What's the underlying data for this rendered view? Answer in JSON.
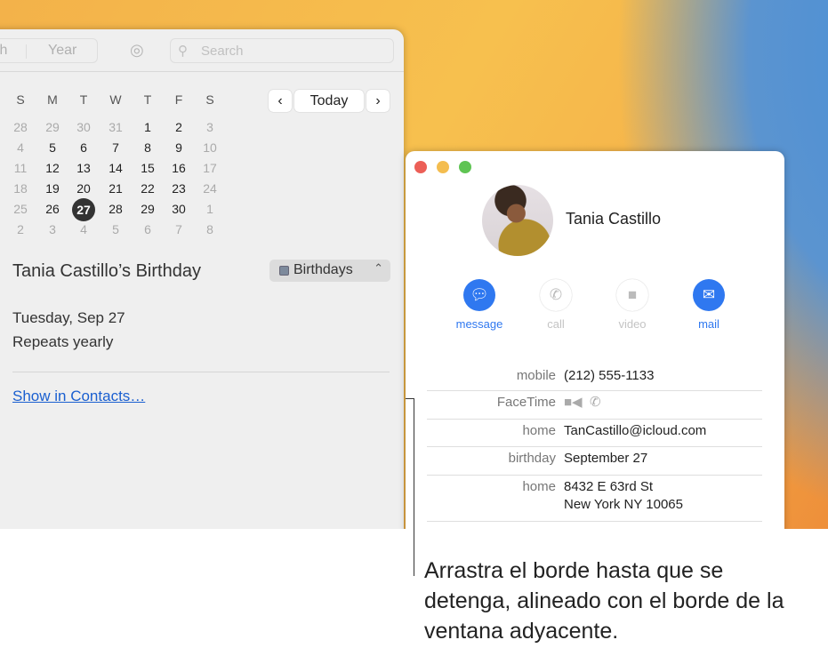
{
  "calendar_window": {
    "toolbar": {
      "view_partial": "th",
      "view_year": "Year",
      "search_placeholder": "Search",
      "icons": [
        "airdrop-icon",
        "search-icon"
      ]
    },
    "weekdays": [
      "S",
      "M",
      "T",
      "W",
      "T",
      "F",
      "S"
    ],
    "weeks": [
      [
        "28",
        "29",
        "30",
        "31",
        "1",
        "2",
        "3"
      ],
      [
        "4",
        "5",
        "6",
        "7",
        "8",
        "9",
        "10"
      ],
      [
        "11",
        "12",
        "13",
        "14",
        "15",
        "16",
        "17"
      ],
      [
        "18",
        "19",
        "20",
        "21",
        "22",
        "23",
        "24"
      ],
      [
        "25",
        "26",
        "27",
        "28",
        "29",
        "30",
        "1"
      ],
      [
        "2",
        "3",
        "4",
        "5",
        "6",
        "7",
        "8"
      ]
    ],
    "selected_day": "27",
    "nav": {
      "prev": "‹",
      "today": "Today",
      "next": "›"
    },
    "event": {
      "title": "Tania Castillo’s Birthday",
      "calendar": "Birthdays",
      "calendar_color": "#7d8a9c",
      "date": "Tuesday, Sep 27",
      "repeat": "Repeats yearly",
      "link": "Show in Contacts…"
    }
  },
  "contacts_window": {
    "name": "Tania Castillo",
    "actions": [
      {
        "label": "message",
        "icon": "message-icon",
        "enabled": true
      },
      {
        "label": "call",
        "icon": "phone-icon",
        "enabled": false
      },
      {
        "label": "video",
        "icon": "video-icon",
        "enabled": false
      },
      {
        "label": "mail",
        "icon": "mail-icon",
        "enabled": true
      }
    ],
    "fields": [
      {
        "label": "mobile",
        "value": "(212) 555-1133"
      },
      {
        "label": "FaceTime",
        "value": ""
      },
      {
        "label": "home",
        "value": "TanCastillo@icloud.com"
      },
      {
        "label": "birthday",
        "value": "September 27"
      },
      {
        "label": "home",
        "value": "8432 E 63rd St",
        "value2": "New York NY 10065"
      }
    ],
    "accent": "#2f78f0"
  },
  "caption": "Arrastra el borde hasta que se detenga, alineado con el borde de la ventana adyacente."
}
